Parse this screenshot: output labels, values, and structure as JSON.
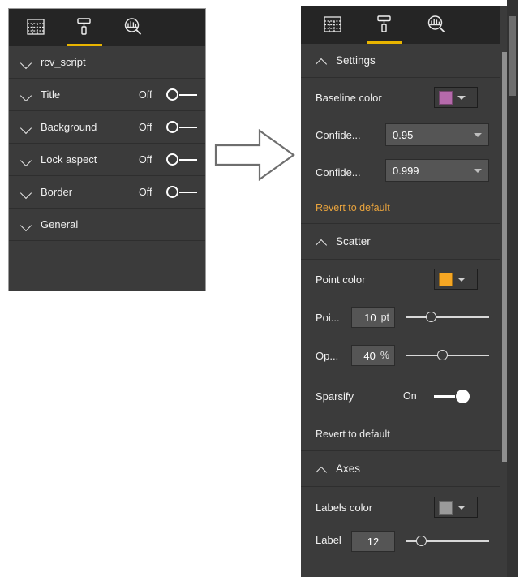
{
  "tabs": [
    {
      "name": "fields-tab",
      "icon": "table-grid-icon",
      "selected": false
    },
    {
      "name": "format-tab",
      "icon": "paint-roller-icon",
      "selected": true
    },
    {
      "name": "analytics-tab",
      "icon": "chart-magnifier-icon",
      "selected": false
    }
  ],
  "colors": {
    "panel_bg": "#3b3b3b",
    "tabbar_bg": "#252525",
    "accent_underline": "#e8b400",
    "revert_amber": "#e8a33d",
    "baseline_swatch": "#b56aab",
    "point_swatch": "#f5a623",
    "labels_swatch": "#9a9a9a",
    "text": "#f0f0f0"
  },
  "left_panel": {
    "name": "format-pane-collapsed",
    "rows": [
      {
        "label": "rcv_script",
        "chevron": "down",
        "toggle": null,
        "state": null
      },
      {
        "label": "Title",
        "chevron": "down",
        "toggle": "off",
        "state": "Off"
      },
      {
        "label": "Background",
        "chevron": "down",
        "toggle": "off",
        "state": "Off"
      },
      {
        "label": "Lock aspect",
        "chevron": "down",
        "toggle": "off",
        "state": "Off"
      },
      {
        "label": "Border",
        "chevron": "down",
        "toggle": "off",
        "state": "Off"
      },
      {
        "label": "General",
        "chevron": "down",
        "toggle": null,
        "state": null
      }
    ]
  },
  "right_panel": {
    "name": "format-pane-expanded",
    "sections": {
      "settings": {
        "header": "Settings",
        "chevron": "up",
        "baseline_color_label": "Baseline color",
        "baseline_color_value": "#b56aab",
        "confidence1_label": "Confide...",
        "confidence1_value": "0.95",
        "confidence2_label": "Confide...",
        "confidence2_value": "0.999",
        "revert": "Revert to default"
      },
      "scatter": {
        "header": "Scatter",
        "chevron": "up",
        "point_color_label": "Point color",
        "point_color_value": "#f5a623",
        "point_size_label": "Poi...",
        "point_size_value": "10",
        "point_size_unit": "pt",
        "point_size_fill_pct": 30,
        "opacity_label": "Op...",
        "opacity_value": "40",
        "opacity_unit": "%",
        "opacity_fill_pct": 42,
        "sparsify_label": "Sparsify",
        "sparsify_state": "On",
        "revert": "Revert to default"
      },
      "axes": {
        "header": "Axes",
        "chevron": "up",
        "labels_color_label": "Labels color",
        "labels_color_value": "#9a9a9a",
        "label_size_label": "Label",
        "label_size_value": "12",
        "label_size_fill_pct": 15
      }
    }
  },
  "arrow": {
    "name": "transition-arrow",
    "direction": "right"
  }
}
